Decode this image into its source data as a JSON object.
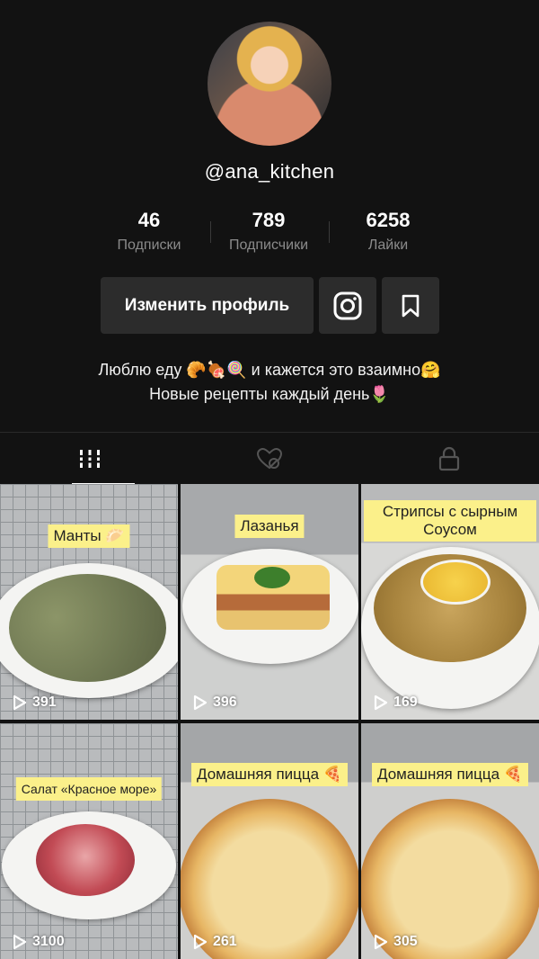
{
  "profile": {
    "username": "@ana_kitchen",
    "stats": [
      {
        "value": "46",
        "label": "Подписки"
      },
      {
        "value": "789",
        "label": "Подписчики"
      },
      {
        "value": "6258",
        "label": "Лайки"
      }
    ],
    "edit_button": "Изменить профиль",
    "bio_line1": "Люблю еду 🥐🍖🍭 и кажется это взаимно🤗",
    "bio_line2": "Новые рецепты каждый день🌷"
  },
  "tabs": [
    {
      "icon": "grid-icon",
      "active": true
    },
    {
      "icon": "liked-hidden-icon",
      "active": false
    },
    {
      "icon": "lock-icon",
      "active": false
    }
  ],
  "videos": [
    {
      "caption": "Манты 🥟",
      "plays": "391"
    },
    {
      "caption": "Лазанья",
      "plays": "396"
    },
    {
      "caption_line1": "Стрипсы с сырным",
      "caption_line2": "Соусом",
      "plays": "169"
    },
    {
      "caption": "Салат «Красное море»",
      "plays": "3100"
    },
    {
      "caption": "Домашняя пицца 🍕",
      "plays": "261"
    },
    {
      "caption": "Домашняя пицца 🍕",
      "plays": "305"
    }
  ]
}
